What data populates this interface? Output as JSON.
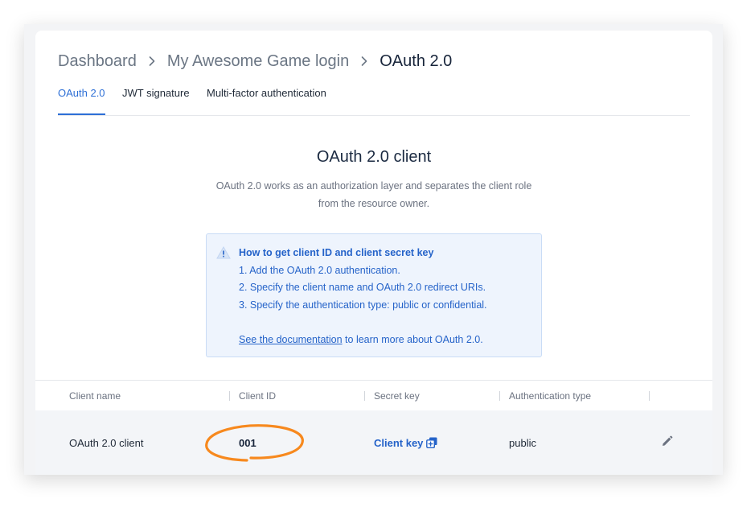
{
  "breadcrumb": {
    "items": [
      "Dashboard",
      "My Awesome Game login"
    ],
    "current": "OAuth 2.0"
  },
  "tabs": [
    {
      "label": "OAuth 2.0",
      "active": true
    },
    {
      "label": "JWT signature",
      "active": false
    },
    {
      "label": "Multi-factor authentication",
      "active": false
    }
  ],
  "section": {
    "title": "OAuth 2.0 client",
    "description_line1": "OAuth 2.0 works as an authorization layer and separates the client role",
    "description_line2": "from the resource owner."
  },
  "info": {
    "title": "How to get client ID and client secret key",
    "steps": [
      "1. Add the OAuth 2.0 authentication.",
      "2. Specify the client name and OAuth 2.0 redirect URIs.",
      "3. Specify the authentication type: public or confidential."
    ],
    "link_text": "See the documentation",
    "link_suffix": " to learn more about OAuth 2.0.",
    "icon": "warning-triangle-icon"
  },
  "table": {
    "headers": [
      "Client name",
      "Client ID",
      "Secret key",
      "Authentication type"
    ],
    "rows": [
      {
        "client_name": "OAuth 2.0 client",
        "client_id": "001",
        "secret_key": "Client key",
        "auth_type": "public"
      }
    ]
  },
  "colors": {
    "accent": "#2d6fd6",
    "link": "#2563c9",
    "highlight": "#f7891e"
  }
}
